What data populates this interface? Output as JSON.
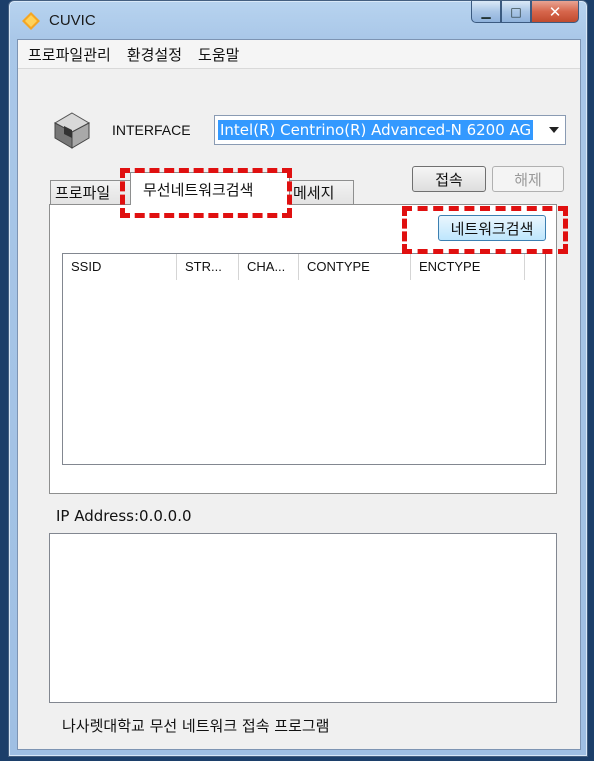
{
  "window": {
    "title": "CUVIC",
    "minimize_glyph": "▁",
    "maximize_glyph": "□",
    "close_glyph": "✕"
  },
  "menu": [
    "프로파일관리",
    "환경설정",
    "도움말"
  ],
  "interface": {
    "label": "INTERFACE",
    "selected": "Intel(R) Centrino(R) Advanced-N 6200 AG"
  },
  "buttons": {
    "connect": "접속",
    "disconnect": "해제",
    "scan": "네트워크검색"
  },
  "tabs": [
    "프로파일",
    "무선네트워크검색",
    "메세지"
  ],
  "network_list": {
    "columns": [
      "SSID",
      "STR...",
      "CHA...",
      "CONTYPE",
      "ENCTYPE"
    ],
    "rows": []
  },
  "ip_label": "IP Address:0.0.0.0",
  "footer": "나사렛대학교 무선 네트워크 접속 프로그램",
  "colors": {
    "highlight": "#e01010",
    "selection": "#3399ff"
  }
}
